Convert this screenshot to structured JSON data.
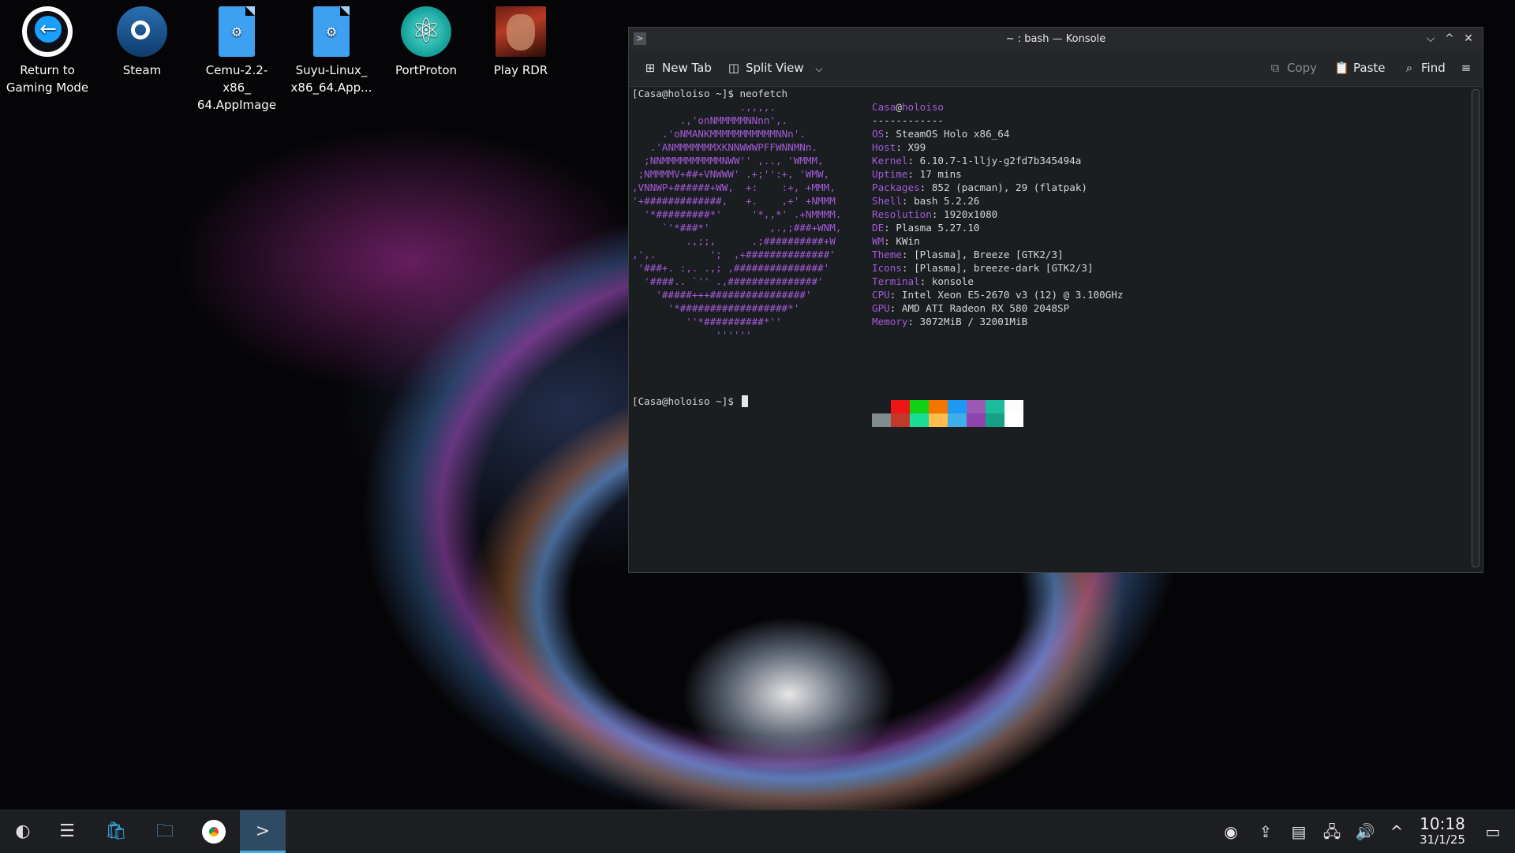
{
  "desktop": {
    "icons": [
      {
        "label": "Return to\nGaming Mode",
        "icon": "steamos-return-icon"
      },
      {
        "label": "Steam",
        "icon": "steam-icon"
      },
      {
        "label": "Cemu-2.2-x86_\n64.AppImage",
        "icon": "appimage-file-icon"
      },
      {
        "label": "Suyu-Linux_\nx86_64.App...",
        "icon": "appimage-file-icon"
      },
      {
        "label": "PortProton",
        "icon": "portproton-icon"
      },
      {
        "label": "Play RDR",
        "icon": "rdr-game-icon"
      }
    ]
  },
  "window": {
    "title": "~ : bash — Konsole",
    "toolbar": {
      "new_tab": "New Tab",
      "split_view": "Split View",
      "copy": "Copy",
      "paste": "Paste",
      "find": "Find"
    },
    "terminal": {
      "prompt1": "[Casa@holoiso ~]$ neofetch",
      "art": [
        "                  .,,,,.",
        "        .,'onNMMMMMNNnn',.",
        "     .'oNMANKMMMMMMMMMMMNNn'.",
        "   .'ANMMMMMMMXKNNWWWPFFWNNMNn.",
        "  ;NNMMMMMMMMMMNWW'' ,.., 'WMMM,",
        " ;NMMMMV+##+VNWWW' .+;'':+, 'WMW,",
        ",VNNWP+######+WW,  +:    :+, +MMM,",
        "'+#############,   +.    ,+' +NMMM",
        "  '*#########*'     '*,,*' .+NMMMM.",
        "     `'*###*'          ,.,;###+WNM,",
        "         .,;;,      .;##########+W",
        ",',.         ';  ,+##############'",
        " '###+. :,. .,; ,###############'",
        "  '####.. `'' .,###############'",
        "    '#####+++################'",
        "      '*##################*'",
        "         ''*##########*''",
        "              ''''''"
      ],
      "info_header": {
        "user": "Casa",
        "at": "@",
        "host": "holoiso"
      },
      "separator": "------------",
      "info": [
        {
          "key": "OS",
          "value": "SteamOS Holo x86_64"
        },
        {
          "key": "Host",
          "value": "X99"
        },
        {
          "key": "Kernel",
          "value": "6.10.7-1-lljy-g2fd7b345494a"
        },
        {
          "key": "Uptime",
          "value": "17 mins"
        },
        {
          "key": "Packages",
          "value": "852 (pacman), 29 (flatpak)"
        },
        {
          "key": "Shell",
          "value": "bash 5.2.26"
        },
        {
          "key": "Resolution",
          "value": "1920x1080"
        },
        {
          "key": "DE",
          "value": "Plasma 5.27.10"
        },
        {
          "key": "WM",
          "value": "KWin"
        },
        {
          "key": "Theme",
          "value": "[Plasma], Breeze [GTK2/3]"
        },
        {
          "key": "Icons",
          "value": "[Plasma], breeze-dark [GTK2/3]"
        },
        {
          "key": "Terminal",
          "value": "konsole"
        },
        {
          "key": "CPU",
          "value": "Intel Xeon E5-2670 v3 (12) @ 3.100GHz"
        },
        {
          "key": "GPU",
          "value": "AMD ATI Radeon RX 580 2048SP"
        },
        {
          "key": "Memory",
          "value": "3072MiB / 32001MiB"
        }
      ],
      "palette_top": [
        "#1b1e20",
        "#ed1515",
        "#11d116",
        "#f67400",
        "#1d99f3",
        "#9b59b6",
        "#1abc9c",
        "#fcfcfc"
      ],
      "palette_bottom": [
        "#7f8c8d",
        "#c0392b",
        "#1cdc9a",
        "#fdbc4b",
        "#3daee9",
        "#8e44ad",
        "#16a085",
        "#ffffff"
      ],
      "prompt2": "[Casa@holoiso ~]$"
    }
  },
  "taskbar": {
    "items": [
      {
        "icon": "steamos-launcher-icon"
      },
      {
        "icon": "system-settings-icon"
      },
      {
        "icon": "discover-store-icon"
      },
      {
        "icon": "dolphin-files-icon"
      },
      {
        "icon": "chrome-icon"
      },
      {
        "icon": "konsole-icon"
      }
    ],
    "tray": [
      "steam-tray-icon",
      "update-icon",
      "clipboard-icon",
      "network-icon",
      "volume-icon",
      "expand-tray-icon"
    ],
    "time": "10:18",
    "date": "31/1/25"
  }
}
